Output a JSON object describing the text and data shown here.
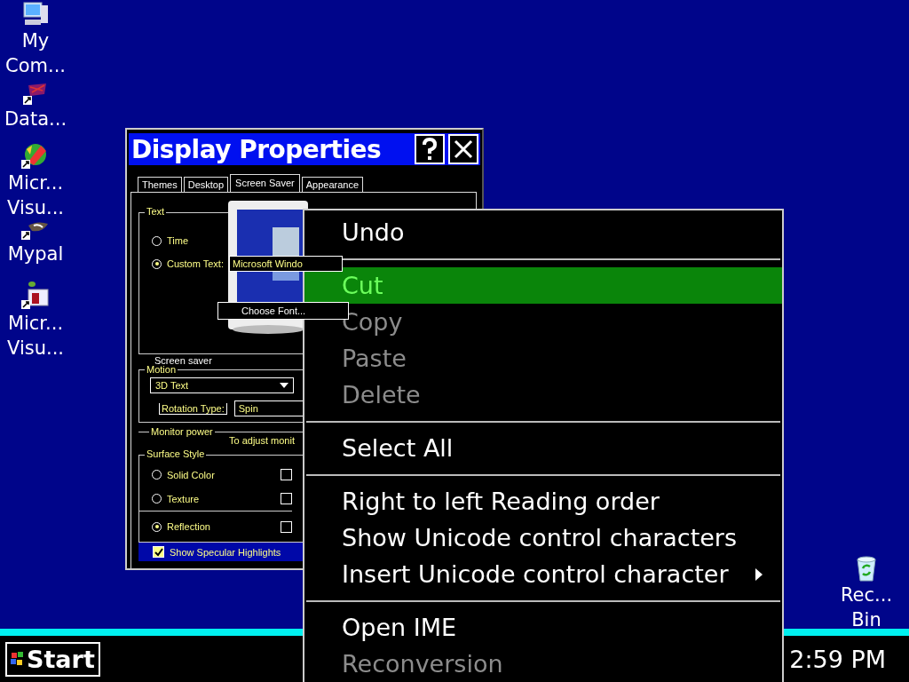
{
  "desktop_icons": [
    {
      "kind": "computer",
      "lines": [
        "My",
        "Com..."
      ]
    },
    {
      "kind": "database",
      "lines": [
        "Data..."
      ]
    },
    {
      "kind": "studio",
      "lines": [
        "Micr...",
        "Visu..."
      ]
    },
    {
      "kind": "bird",
      "lines": [
        "Mypal"
      ]
    },
    {
      "kind": "setup",
      "lines": [
        "Micr...",
        "Visu..."
      ]
    },
    {
      "kind": "recycle",
      "lines": [
        "Rec...",
        "Bin"
      ]
    }
  ],
  "dialog": {
    "title": "Display Properties",
    "tabs": [
      {
        "label": "Themes",
        "selected": false
      },
      {
        "label": "Desktop",
        "selected": false
      },
      {
        "label": "Screen Saver",
        "selected": true
      },
      {
        "label": "Appearance",
        "selected": false
      }
    ],
    "text_group": {
      "label": "Text",
      "options": [
        {
          "label": "Time",
          "selected": false
        },
        {
          "label": "Custom Text:",
          "selected": true
        }
      ],
      "custom_text_value": "Microsoft Windo",
      "choose_font_button": "Choose Font..."
    },
    "screen_saver_label": "Screen saver",
    "motion_group": {
      "label": "Motion",
      "effect_value": "3D Text",
      "rotation_label": "Rotation Type:",
      "rotation_value": "Spin"
    },
    "monitor_power_label": "Monitor power",
    "monitor_note": "To adjust monit",
    "surface_group": {
      "label": "Surface Style",
      "options": [
        {
          "label": "Solid Color",
          "selected": false
        },
        {
          "label": "Texture",
          "selected": false
        },
        {
          "label": "Reflection",
          "selected": true
        }
      ]
    },
    "specular": {
      "label": "Show Specular Highlights",
      "checked": true
    }
  },
  "context_menu": [
    {
      "kind": "item",
      "label": "Undo",
      "disabled": false,
      "selected": false,
      "submenu": false
    },
    {
      "kind": "separator"
    },
    {
      "kind": "item",
      "label": "Cut",
      "disabled": false,
      "selected": true,
      "submenu": false
    },
    {
      "kind": "item",
      "label": "Copy",
      "disabled": true,
      "selected": false,
      "submenu": false
    },
    {
      "kind": "item",
      "label": "Paste",
      "disabled": true,
      "selected": false,
      "submenu": false
    },
    {
      "kind": "item",
      "label": "Delete",
      "disabled": true,
      "selected": false,
      "submenu": false
    },
    {
      "kind": "separator"
    },
    {
      "kind": "item",
      "label": "Select All",
      "disabled": false,
      "selected": false,
      "submenu": false
    },
    {
      "kind": "separator"
    },
    {
      "kind": "item",
      "label": "Right to left Reading order",
      "disabled": false,
      "selected": false,
      "submenu": false
    },
    {
      "kind": "item",
      "label": "Show Unicode control characters",
      "disabled": false,
      "selected": false,
      "submenu": false
    },
    {
      "kind": "item",
      "label": "Insert Unicode control character",
      "disabled": false,
      "selected": false,
      "submenu": true
    },
    {
      "kind": "separator"
    },
    {
      "kind": "item",
      "label": "Open IME",
      "disabled": false,
      "selected": false,
      "submenu": false
    },
    {
      "kind": "item",
      "label": "Reconversion",
      "disabled": true,
      "selected": false,
      "submenu": false
    }
  ],
  "taskbar": {
    "start_label": "Start",
    "clock": "2:59 PM"
  }
}
